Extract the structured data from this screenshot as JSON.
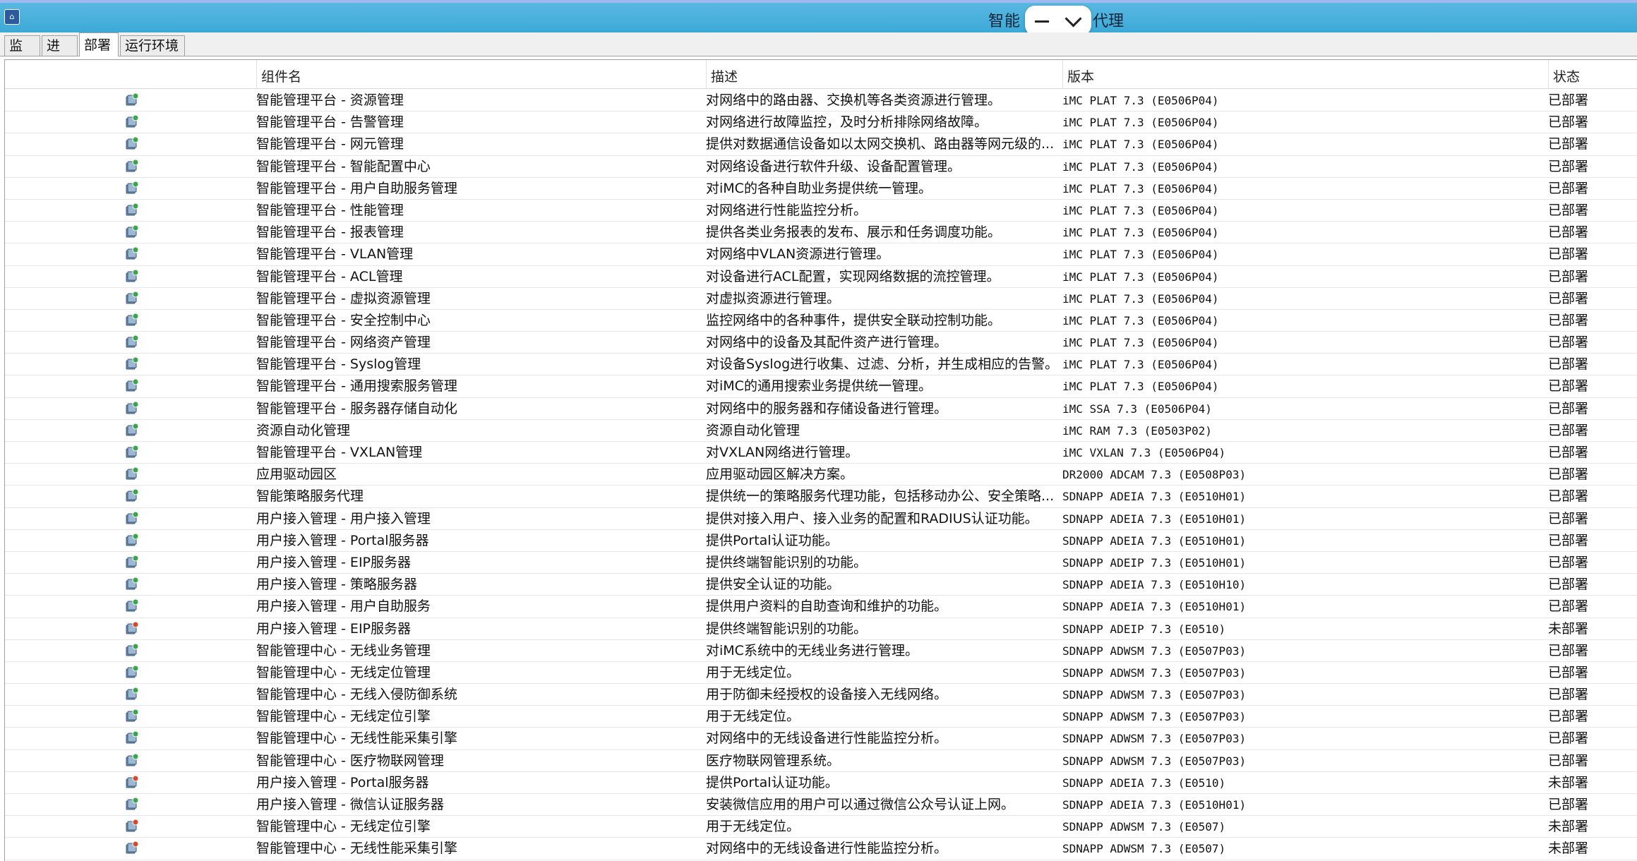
{
  "window": {
    "title_left": "智能",
    "title_right": "代理"
  },
  "tabs": [
    {
      "label": "监控"
    },
    {
      "label": "进程"
    },
    {
      "label": "部署"
    },
    {
      "label": "运行环境"
    }
  ],
  "table": {
    "headers": {
      "name": "组件名",
      "desc": "描述",
      "version": "版本",
      "status": "状态"
    },
    "rows": [
      {
        "icon": "component-deployed-icon",
        "name": "智能管理平台 - 资源管理",
        "desc": "对网络中的路由器、交换机等各类资源进行管理。",
        "version": "iMC PLAT 7.3 (E0506P04)",
        "status": "已部署"
      },
      {
        "icon": "component-deployed-icon",
        "name": "智能管理平台 - 告警管理",
        "desc": "对网络进行故障监控，及时分析排除网络故障。",
        "version": "iMC PLAT 7.3 (E0506P04)",
        "status": "已部署"
      },
      {
        "icon": "component-deployed-icon",
        "name": "智能管理平台 - 网元管理",
        "desc": "提供对数据通信设备如以太网交换机、路由器等网元级的...",
        "version": "iMC PLAT 7.3 (E0506P04)",
        "status": "已部署"
      },
      {
        "icon": "component-deployed-icon",
        "name": "智能管理平台 - 智能配置中心",
        "desc": "对网络设备进行软件升级、设备配置管理。",
        "version": "iMC PLAT 7.3 (E0506P04)",
        "status": "已部署"
      },
      {
        "icon": "component-deployed-icon",
        "name": "智能管理平台 - 用户自助服务管理",
        "desc": "对iMC的各种自助业务提供统一管理。",
        "version": "iMC PLAT 7.3 (E0506P04)",
        "status": "已部署"
      },
      {
        "icon": "component-deployed-icon",
        "name": "智能管理平台 - 性能管理",
        "desc": "对网络进行性能监控分析。",
        "version": "iMC PLAT 7.3 (E0506P04)",
        "status": "已部署"
      },
      {
        "icon": "component-deployed-icon",
        "name": "智能管理平台 - 报表管理",
        "desc": "提供各类业务报表的发布、展示和任务调度功能。",
        "version": "iMC PLAT 7.3 (E0506P04)",
        "status": "已部署"
      },
      {
        "icon": "component-deployed-icon",
        "name": "智能管理平台 - VLAN管理",
        "desc": "对网络中VLAN资源进行管理。",
        "version": "iMC PLAT 7.3 (E0506P04)",
        "status": "已部署"
      },
      {
        "icon": "component-deployed-icon",
        "name": "智能管理平台 - ACL管理",
        "desc": "对设备进行ACL配置，实现网络数据的流控管理。",
        "version": "iMC PLAT 7.3 (E0506P04)",
        "status": "已部署"
      },
      {
        "icon": "component-deployed-icon",
        "name": "智能管理平台 - 虚拟资源管理",
        "desc": "对虚拟资源进行管理。",
        "version": "iMC PLAT 7.3 (E0506P04)",
        "status": "已部署"
      },
      {
        "icon": "component-deployed-icon",
        "name": "智能管理平台 - 安全控制中心",
        "desc": "监控网络中的各种事件，提供安全联动控制功能。",
        "version": "iMC PLAT 7.3 (E0506P04)",
        "status": "已部署"
      },
      {
        "icon": "component-deployed-icon",
        "name": "智能管理平台 - 网络资产管理",
        "desc": "对网络中的设备及其配件资产进行管理。",
        "version": "iMC PLAT 7.3 (E0506P04)",
        "status": "已部署"
      },
      {
        "icon": "component-deployed-icon",
        "name": "智能管理平台 - Syslog管理",
        "desc": "对设备Syslog进行收集、过滤、分析，并生成相应的告警。",
        "version": "iMC PLAT 7.3 (E0506P04)",
        "status": "已部署"
      },
      {
        "icon": "component-deployed-icon",
        "name": "智能管理平台 - 通用搜索服务管理",
        "desc": "对iMC的通用搜索业务提供统一管理。",
        "version": "iMC PLAT 7.3 (E0506P04)",
        "status": "已部署"
      },
      {
        "icon": "component-deployed-icon",
        "name": "智能管理平台 - 服务器存储自动化",
        "desc": "对网络中的服务器和存储设备进行管理。",
        "version": "iMC SSA 7.3 (E0506P04)",
        "status": "已部署"
      },
      {
        "icon": "component-deployed-icon",
        "name": "资源自动化管理",
        "desc": "资源自动化管理",
        "version": "iMC RAM 7.3 (E0503P02)",
        "status": "已部署"
      },
      {
        "icon": "component-deployed-icon",
        "name": "智能管理平台 - VXLAN管理",
        "desc": "对VXLAN网络进行管理。",
        "version": "iMC VXLAN 7.3 (E0506P04)",
        "status": "已部署"
      },
      {
        "icon": "component-deployed-icon",
        "name": "应用驱动园区",
        "desc": "应用驱动园区解决方案。",
        "version": "DR2000 ADCAM 7.3 (E0508P03)",
        "status": "已部署"
      },
      {
        "icon": "component-deployed-icon",
        "name": "智能策略服务代理",
        "desc": "提供统一的策略服务代理功能，包括移动办公、安全策略...",
        "version": "SDNAPP ADEIA 7.3 (E0510H01)",
        "status": "已部署"
      },
      {
        "icon": "component-deployed-icon",
        "name": "用户接入管理 - 用户接入管理",
        "desc": "提供对接入用户、接入业务的配置和RADIUS认证功能。",
        "version": "SDNAPP ADEIA 7.3 (E0510H01)",
        "status": "已部署"
      },
      {
        "icon": "component-deployed-icon",
        "name": "用户接入管理 - Portal服务器",
        "desc": "提供Portal认证功能。",
        "version": "SDNAPP ADEIA 7.3 (E0510H01)",
        "status": "已部署"
      },
      {
        "icon": "component-deployed-icon",
        "name": "用户接入管理 - EIP服务器",
        "desc": "提供终端智能识别的功能。",
        "version": "SDNAPP ADEIP 7.3 (E0510H01)",
        "status": "已部署"
      },
      {
        "icon": "component-deployed-icon",
        "name": "用户接入管理 - 策略服务器",
        "desc": "提供安全认证的功能。",
        "version": "SDNAPP ADEIA 7.3 (E0510H10)",
        "status": "已部署"
      },
      {
        "icon": "component-deployed-icon",
        "name": "用户接入管理 - 用户自助服务",
        "desc": "提供用户资料的自助查询和维护的功能。",
        "version": "SDNAPP ADEIA 7.3 (E0510H01)",
        "status": "已部署"
      },
      {
        "icon": "component-undeployed-icon",
        "name": "用户接入管理 - EIP服务器",
        "desc": "提供终端智能识别的功能。",
        "version": "SDNAPP ADEIP 7.3 (E0510)",
        "status": "未部署"
      },
      {
        "icon": "component-deployed-icon",
        "name": "智能管理中心 - 无线业务管理",
        "desc": "对iMC系统中的无线业务进行管理。",
        "version": "SDNAPP ADWSM 7.3 (E0507P03)",
        "status": "已部署"
      },
      {
        "icon": "component-deployed-icon",
        "name": "智能管理中心 - 无线定位管理",
        "desc": "用于无线定位。",
        "version": "SDNAPP ADWSM 7.3 (E0507P03)",
        "status": "已部署"
      },
      {
        "icon": "component-deployed-icon",
        "name": "智能管理中心 - 无线入侵防御系统",
        "desc": "用于防御未经授权的设备接入无线网络。",
        "version": "SDNAPP ADWSM 7.3 (E0507P03)",
        "status": "已部署"
      },
      {
        "icon": "component-deployed-icon",
        "name": "智能管理中心 - 无线定位引擎",
        "desc": "用于无线定位。",
        "version": "SDNAPP ADWSM 7.3 (E0507P03)",
        "status": "已部署"
      },
      {
        "icon": "component-deployed-icon",
        "name": "智能管理中心 - 无线性能采集引擎",
        "desc": "对网络中的无线设备进行性能监控分析。",
        "version": "SDNAPP ADWSM 7.3 (E0507P03)",
        "status": "已部署"
      },
      {
        "icon": "component-deployed-icon",
        "name": "智能管理中心 - 医疗物联网管理",
        "desc": "医疗物联网管理系统。",
        "version": "SDNAPP ADWSM 7.3 (E0507P03)",
        "status": "已部署"
      },
      {
        "icon": "component-undeployed-icon",
        "name": "用户接入管理 - Portal服务器",
        "desc": "提供Portal认证功能。",
        "version": "SDNAPP ADEIA 7.3 (E0510)",
        "status": "未部署"
      },
      {
        "icon": "component-deployed-icon",
        "name": "用户接入管理 - 微信认证服务器",
        "desc": "安装微信应用的用户可以通过微信公众号认证上网。",
        "version": "SDNAPP ADEIA 7.3 (E0510H01)",
        "status": "已部署"
      },
      {
        "icon": "component-undeployed-icon",
        "name": "智能管理中心 - 无线定位引擎",
        "desc": "用于无线定位。",
        "version": "SDNAPP ADWSM 7.3 (E0507)",
        "status": "未部署"
      },
      {
        "icon": "component-undeployed-icon",
        "name": "智能管理中心 - 无线性能采集引擎",
        "desc": "对网络中的无线设备进行性能监控分析。",
        "version": "SDNAPP ADWSM 7.3 (E0507)",
        "status": "未部署"
      }
    ]
  },
  "colors": {
    "titlebar": "#3ca9d6",
    "deployed_icon": "#3aa64a",
    "undeployed_icon": "#d9482b"
  }
}
